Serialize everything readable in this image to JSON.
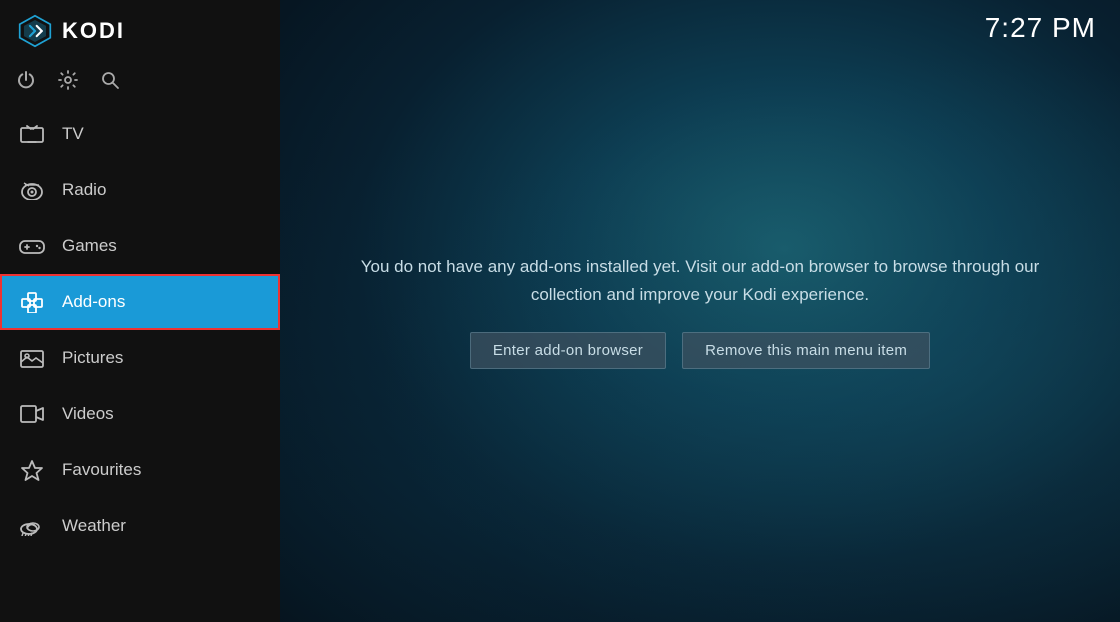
{
  "header": {
    "title": "KODI",
    "clock": "7:27 PM"
  },
  "sidebar": {
    "toolbar": {
      "power_icon": "⏻",
      "settings_icon": "⚙",
      "search_icon": "⌕"
    },
    "items": [
      {
        "id": "tv",
        "label": "TV",
        "icon": "tv"
      },
      {
        "id": "radio",
        "label": "Radio",
        "icon": "radio"
      },
      {
        "id": "games",
        "label": "Games",
        "icon": "games"
      },
      {
        "id": "addons",
        "label": "Add-ons",
        "icon": "addons",
        "active": true
      },
      {
        "id": "pictures",
        "label": "Pictures",
        "icon": "pictures"
      },
      {
        "id": "videos",
        "label": "Videos",
        "icon": "videos"
      },
      {
        "id": "favourites",
        "label": "Favourites",
        "icon": "favourites"
      },
      {
        "id": "weather",
        "label": "Weather",
        "icon": "weather"
      }
    ]
  },
  "main": {
    "message": "You do not have any add-ons installed yet. Visit our add-on browser to browse through our collection and improve your Kodi experience.",
    "buttons": [
      {
        "id": "enter-browser",
        "label": "Enter add-on browser"
      },
      {
        "id": "remove-item",
        "label": "Remove this main menu item"
      }
    ]
  }
}
